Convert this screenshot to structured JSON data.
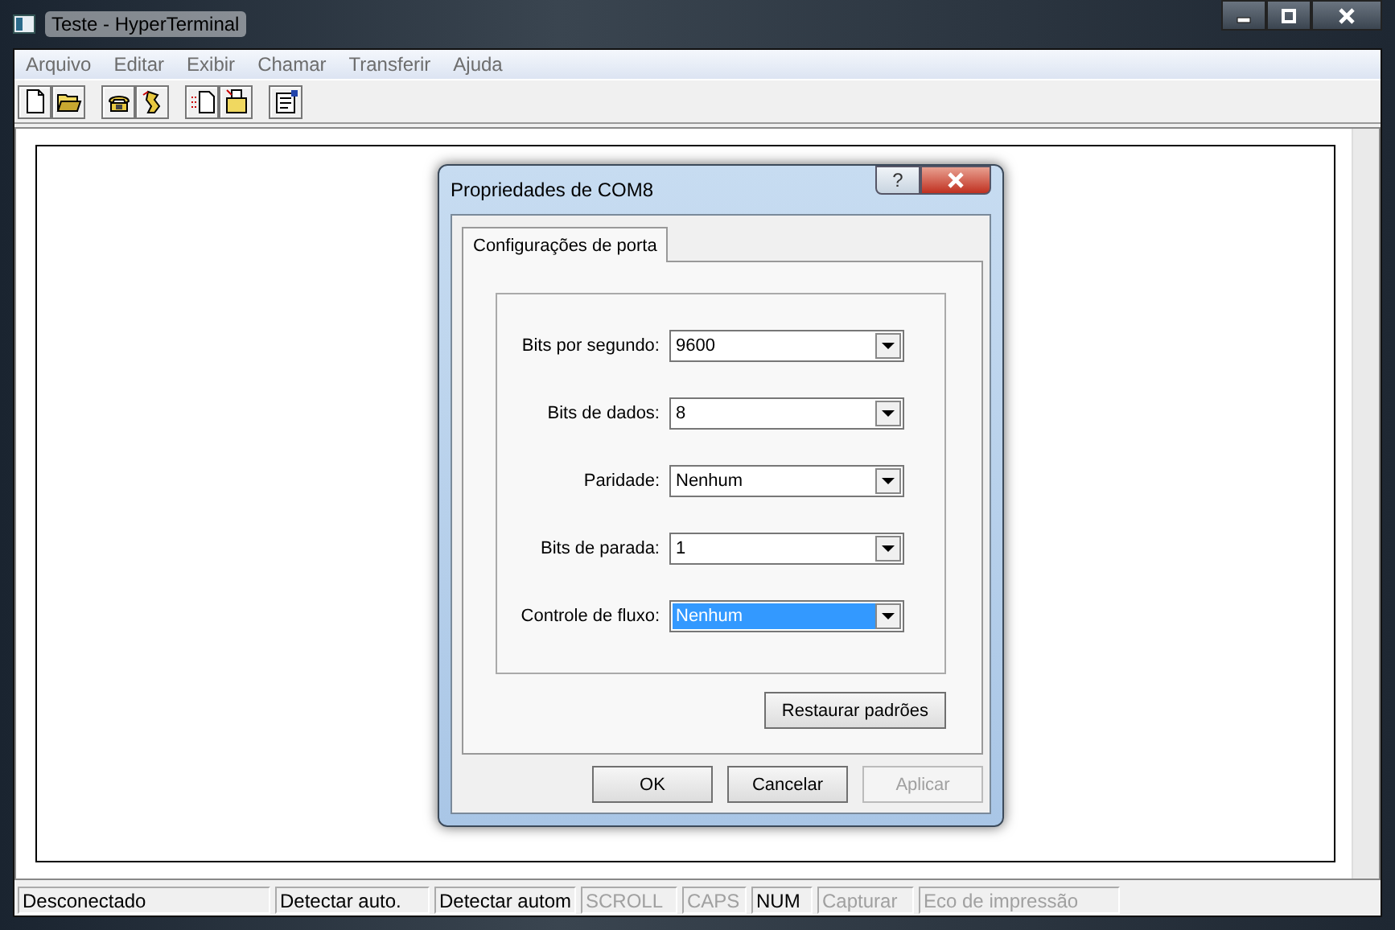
{
  "window": {
    "title": "Teste - HyperTerminal"
  },
  "menu": [
    {
      "label": "Arquivo"
    },
    {
      "label": "Editar"
    },
    {
      "label": "Exibir"
    },
    {
      "label": "Chamar"
    },
    {
      "label": "Transferir"
    },
    {
      "label": "Ajuda"
    }
  ],
  "toolbar": [
    {
      "kind": "new"
    },
    {
      "kind": "open"
    },
    {
      "kind": "sep"
    },
    {
      "kind": "phone"
    },
    {
      "kind": "hangup"
    },
    {
      "kind": "sep"
    },
    {
      "kind": "send"
    },
    {
      "kind": "receive"
    },
    {
      "kind": "sep"
    },
    {
      "kind": "properties"
    }
  ],
  "dialog": {
    "title": "Propriedades de COM8",
    "help": "?",
    "tabs": [
      {
        "label": "Configurações de porta",
        "selected": true
      }
    ],
    "fields": [
      {
        "label": "Bits por segundo:",
        "value": "9600",
        "selected": false
      },
      {
        "label": "Bits de dados:",
        "value": "8",
        "selected": false
      },
      {
        "label": "Paridade:",
        "value": "Nenhum",
        "selected": false
      },
      {
        "label": "Bits de parada:",
        "value": "1",
        "selected": false
      },
      {
        "label": "Controle de fluxo:",
        "value": "Nenhum",
        "selected": true
      }
    ],
    "restore_button": {
      "label": "Restaurar padrões",
      "disabled": false
    },
    "buttons": [
      {
        "label": "OK",
        "disabled": false
      },
      {
        "label": "Cancelar",
        "disabled": false
      },
      {
        "label": "Aplicar",
        "disabled": true
      }
    ]
  },
  "status_bar": [
    {
      "text": "Desconectado",
      "disabled": false
    },
    {
      "text": "Detectar auto.",
      "disabled": false
    },
    {
      "text": "Detectar autom",
      "disabled": false
    },
    {
      "text": "SCROLL",
      "disabled": true
    },
    {
      "text": "CAPS",
      "disabled": true
    },
    {
      "text": "NUM",
      "disabled": false
    },
    {
      "text": "Capturar",
      "disabled": true
    },
    {
      "text": "Eco de impressão",
      "disabled": true
    }
  ]
}
